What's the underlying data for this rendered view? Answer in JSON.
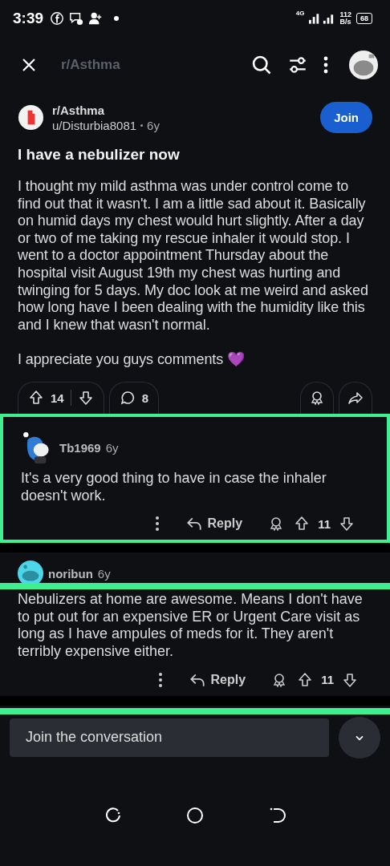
{
  "status_bar": {
    "time": "3:39",
    "network": "4G",
    "speed": "112",
    "speed_unit": "B/s",
    "battery": "68"
  },
  "header": {
    "title": "r/Asthma"
  },
  "post": {
    "subreddit": "r/Asthma",
    "author": "u/Disturbia8081",
    "age": "6y",
    "join_label": "Join",
    "title": "I have a nebulizer now",
    "paragraphs": [
      "I thought my mild asthma was under control come to find out that it wasn't. I am a little sad about it. Basically on humid days my chest would hurt slightly. After a day or two of me taking my rescue inhaler it would stop. I went to a doctor appointment Thursday about the hospital visit August 19th my chest was hurting and twinging for 5 days. My doc look at me weird and asked how long have I been dealing with the humidity like this and I knew that wasn't normal.",
      "I appreciate you guys comments 💜"
    ],
    "votes": "14",
    "comments": "8"
  },
  "comments": [
    {
      "author": "Tb1969",
      "age": "6y",
      "body": "It's a very good thing to have in case the inhaler doesn't work.",
      "reply_label": "Reply",
      "votes": "11",
      "highlighted": true,
      "struck": false
    },
    {
      "author": "noribun",
      "age": "6y",
      "body": "Nebulizers at home are awesome. Means I don't have to put out for an expensive ER or Urgent Care visit as long as I have ampules of meds for it. They aren't terribly expensive either.",
      "reply_label": "Reply",
      "votes": "11",
      "highlighted": false,
      "struck": true
    }
  ],
  "composer": {
    "placeholder": "Join the conversation",
    "struck": true
  }
}
